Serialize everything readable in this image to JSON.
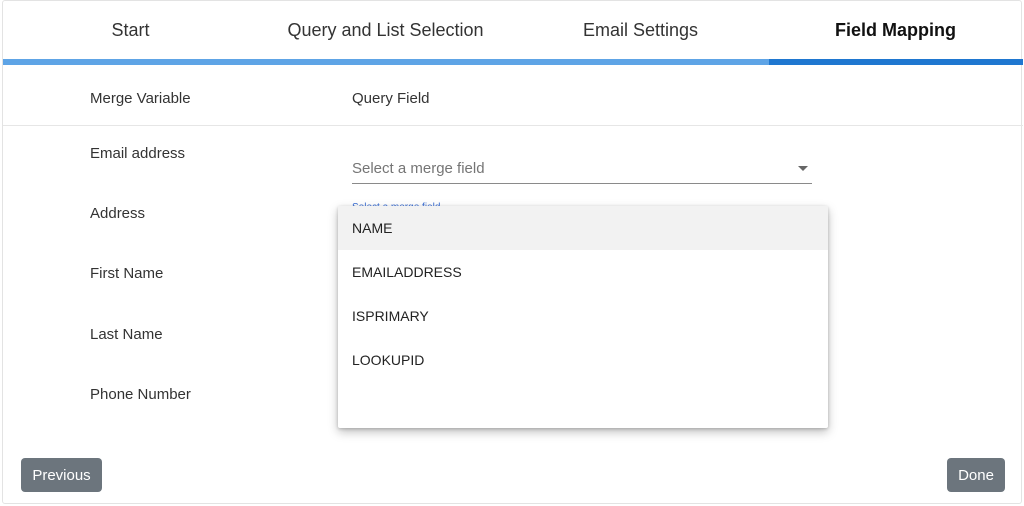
{
  "wizard": {
    "steps": [
      {
        "label": "Start"
      },
      {
        "label": "Query and List Selection"
      },
      {
        "label": "Email Settings"
      },
      {
        "label": "Field Mapping"
      }
    ],
    "active_step": 3,
    "progress_color": "#5ea4e6",
    "active_color": "#1f77d0"
  },
  "table": {
    "header_variable": "Merge Variable",
    "header_field": "Query Field",
    "rows": [
      {
        "variable": "Email address"
      },
      {
        "variable": "Address"
      },
      {
        "variable": "First Name"
      },
      {
        "variable": "Last Name"
      },
      {
        "variable": "Phone Number"
      }
    ]
  },
  "select": {
    "placeholder": "Select a merge field",
    "faint_label": "Select a merge field"
  },
  "dropdown": {
    "options": [
      "NAME",
      "EMAILADDRESS",
      "ISPRIMARY",
      "LOOKUPID"
    ],
    "highlighted_index": 0
  },
  "footer": {
    "previous_label": "Previous",
    "done_label": "Done",
    "button_color": "#6c757d"
  }
}
